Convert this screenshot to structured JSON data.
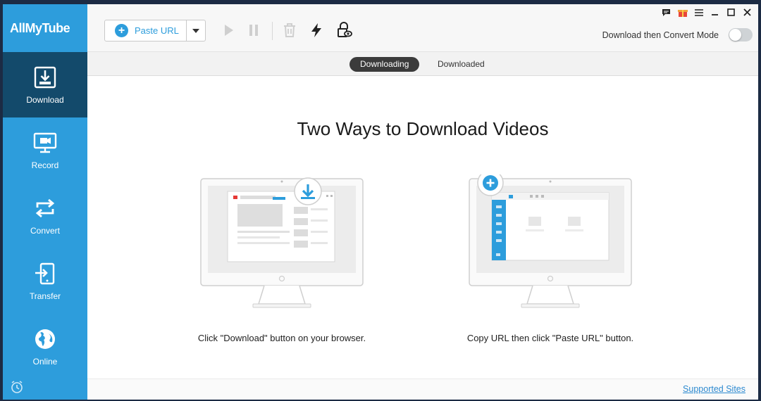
{
  "app": {
    "name": "AllMyTube"
  },
  "sidebar": {
    "items": [
      {
        "label": "Download",
        "icon": "download-icon",
        "active": true
      },
      {
        "label": "Record",
        "icon": "monitor-record-icon"
      },
      {
        "label": "Convert",
        "icon": "convert-icon"
      },
      {
        "label": "Transfer",
        "icon": "transfer-icon"
      },
      {
        "label": "Online",
        "icon": "globe-icon"
      }
    ]
  },
  "toolbar": {
    "paste_url_label": "Paste URL",
    "icons": [
      "play-icon",
      "pause-icon",
      "trash-icon",
      "lightning-icon",
      "private-mode-icon"
    ]
  },
  "window_controls": [
    "feedback-icon",
    "gift-icon",
    "menu-icon",
    "minimize-icon",
    "maximize-icon",
    "close-icon"
  ],
  "mode": {
    "label": "Download then Convert Mode",
    "enabled": false
  },
  "tabs": [
    {
      "label": "Downloading",
      "active": true
    },
    {
      "label": "Downloaded",
      "active": false
    }
  ],
  "main": {
    "heading": "Two Ways to Download Videos",
    "method1_caption": "Click \"Download\" button on your browser.",
    "method2_caption": "Copy URL then click \"Paste URL\" button."
  },
  "footer": {
    "supported_sites_label": "Supported Sites"
  },
  "colors": {
    "accent": "#2d9ddc",
    "active_nav": "#134a6b"
  }
}
